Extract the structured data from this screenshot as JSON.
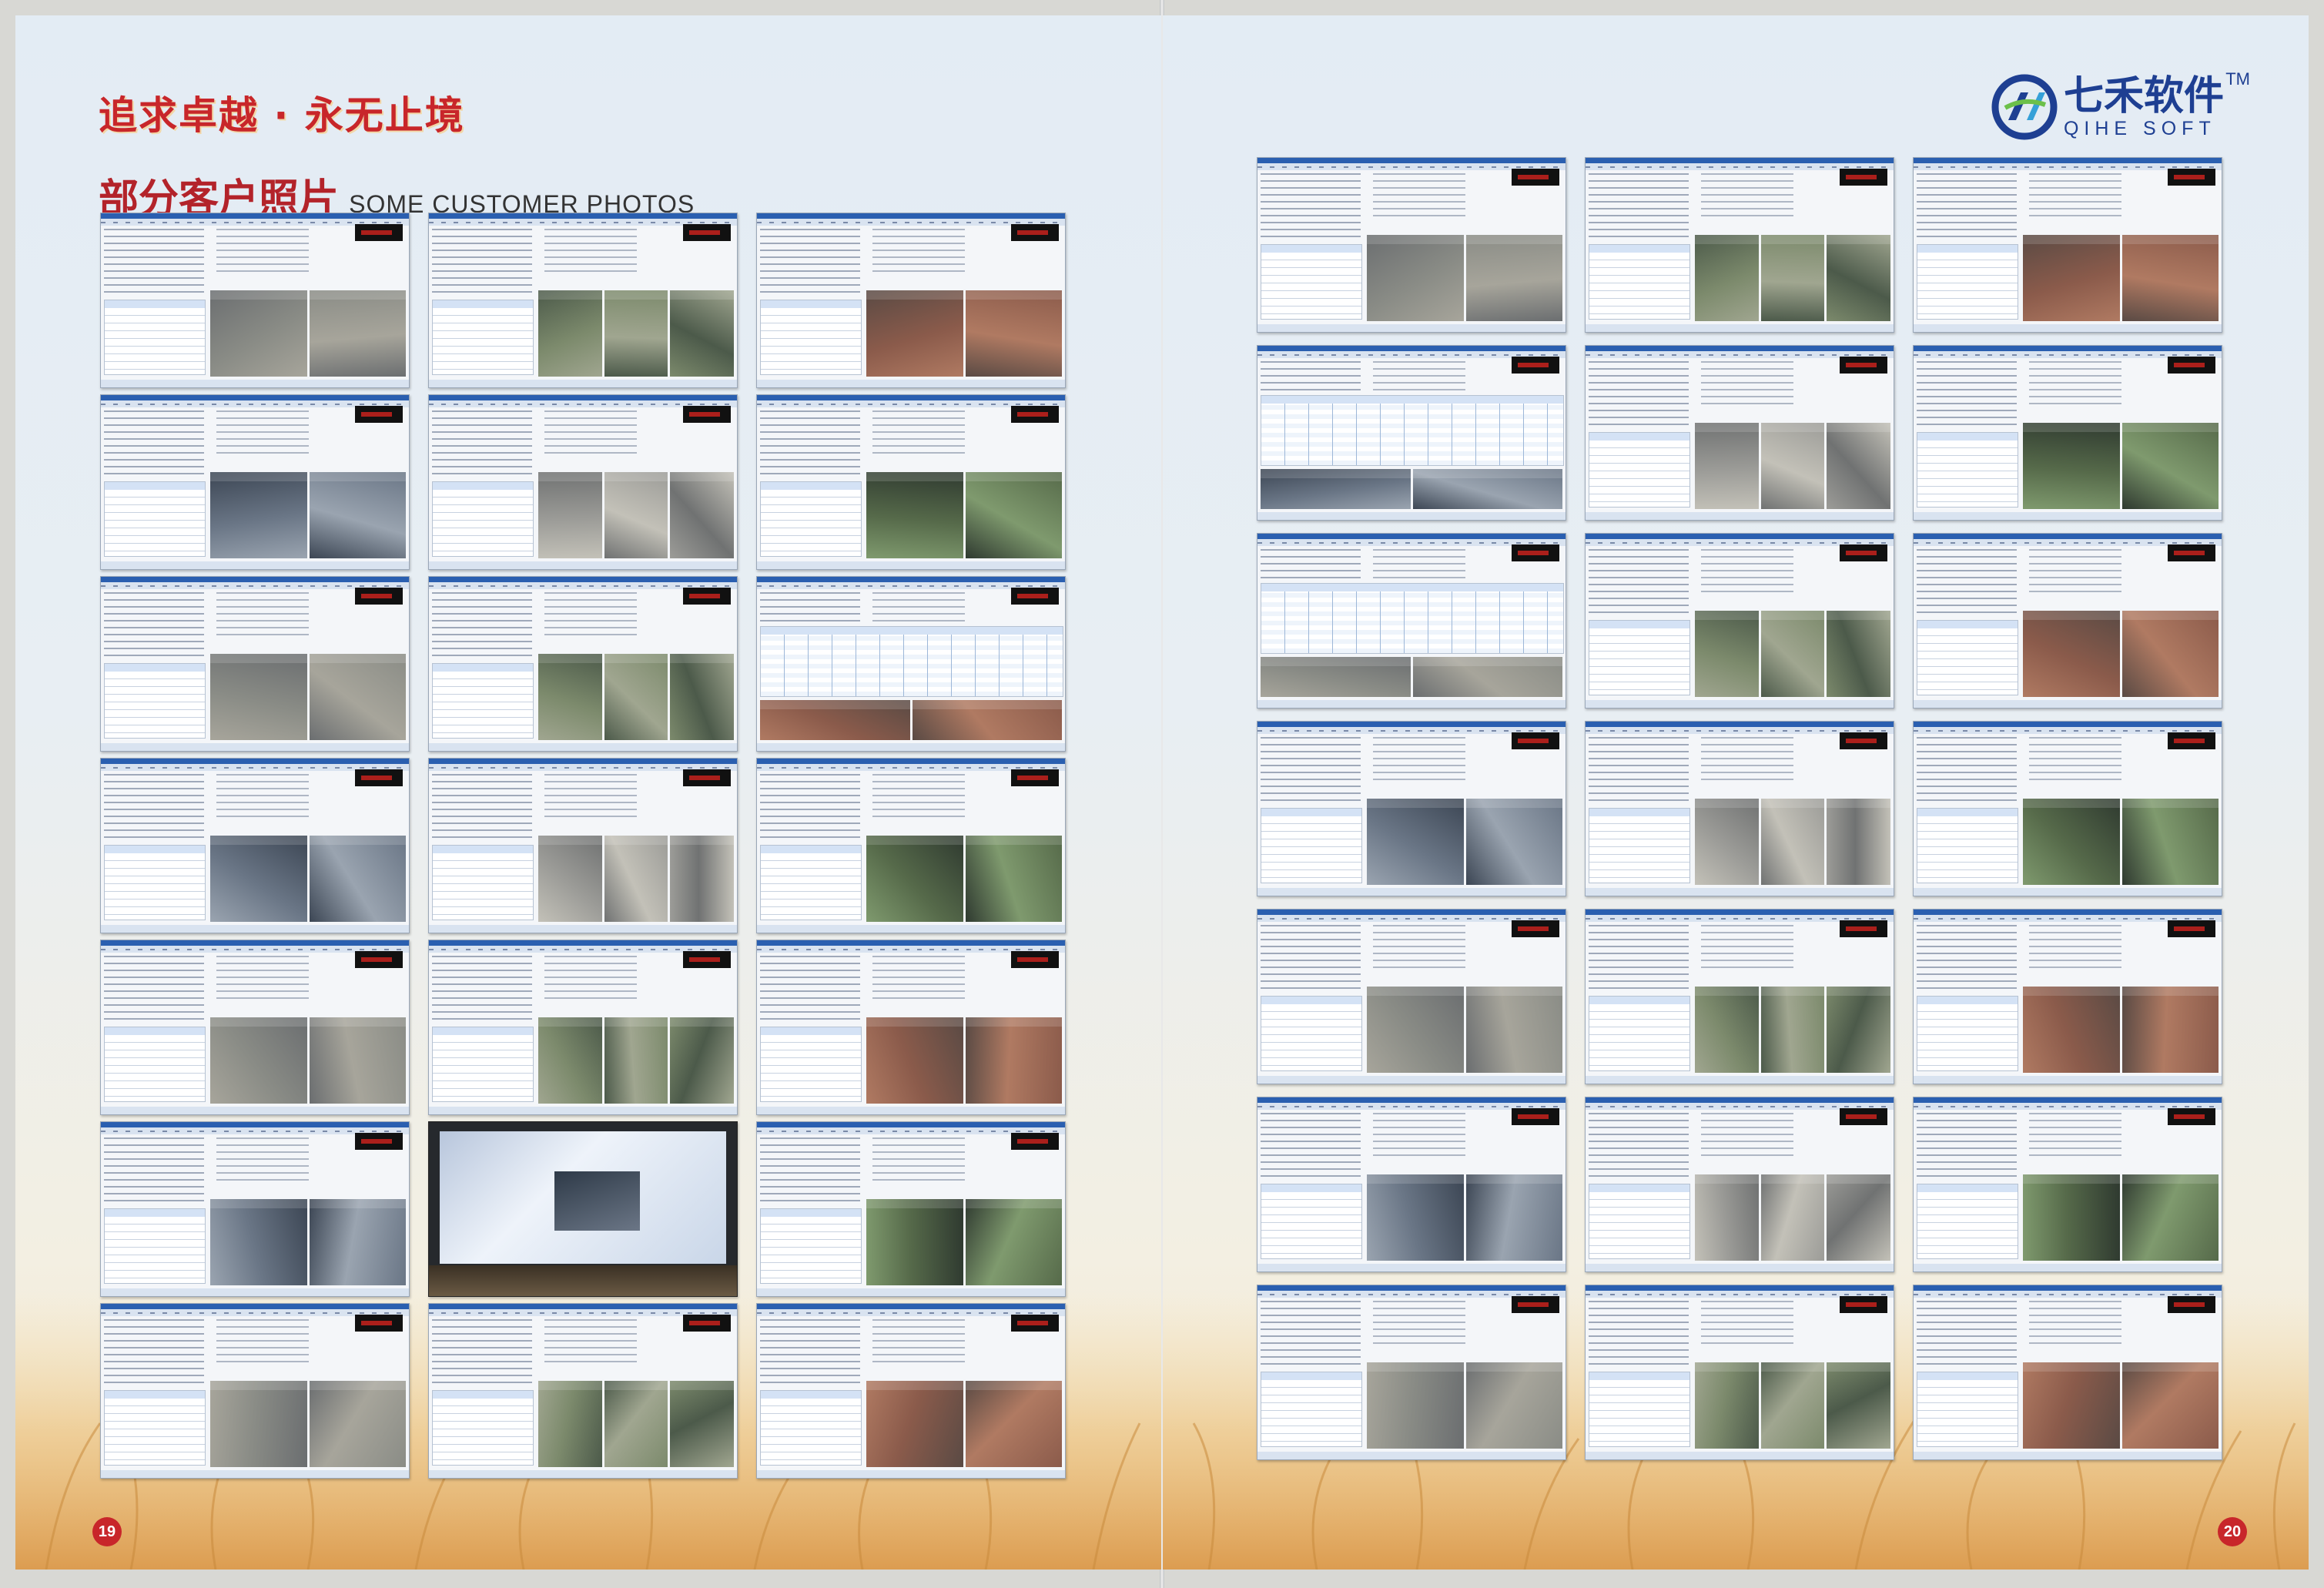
{
  "left_page": {
    "slogan": "追求卓越 · 永无止境",
    "section_title_cn": "部分客户照片",
    "section_title_en": "SOME CUSTOMER PHOTOS",
    "page_number": "19",
    "photo_count": 21
  },
  "right_page": {
    "logo": {
      "cn": "七禾软件",
      "en": "QIHE SOFT",
      "tm": "TM"
    },
    "page_number": "20",
    "photo_count": 21
  },
  "colors": {
    "accent_red": "#c8262a",
    "brand_blue": "#1e3f92",
    "window_titlebar": "#2a5fb0"
  }
}
